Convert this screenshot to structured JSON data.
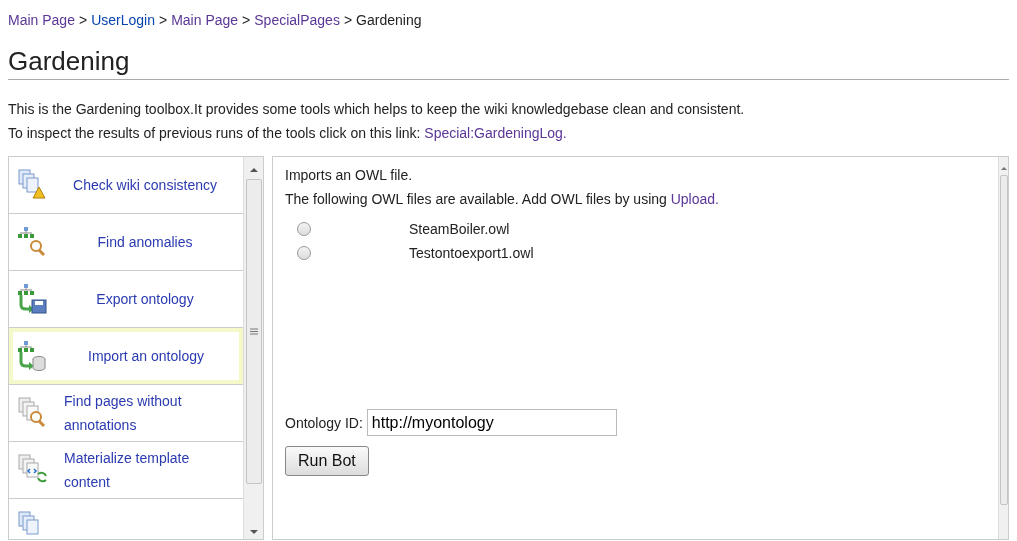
{
  "breadcrumb": [
    {
      "kind": "link",
      "text": "Main Page",
      "visited": true
    },
    {
      "kind": "separator",
      "text": ">"
    },
    {
      "kind": "link",
      "text": "UserLogin",
      "visited": false
    },
    {
      "kind": "separator",
      "text": ">"
    },
    {
      "kind": "link",
      "text": "Main Page",
      "visited": true
    },
    {
      "kind": "separator",
      "text": ">"
    },
    {
      "kind": "link",
      "text": "SpecialPages",
      "visited": true
    },
    {
      "kind": "separator",
      "text": ">"
    },
    {
      "kind": "current",
      "text": "Gardening"
    }
  ],
  "title": "Gardening",
  "intro": [
    {
      "text": "This is the Gardening toolbox.It provides some tools which helps to keep the wiki knowledgebase clean and consistent."
    },
    {
      "text": "To inspect the results of previous runs of the tools click on this link: ",
      "link": {
        "text": "Special:GardeningLog.",
        "visited": true
      }
    }
  ],
  "tools": [
    {
      "label": "Check wiki consistency",
      "selected": false
    },
    {
      "label": "Find anomalies",
      "selected": false
    },
    {
      "label": "Export ontology",
      "selected": false
    },
    {
      "label": "Import an ontology",
      "selected": true
    },
    {
      "label": "Find pages without annotations",
      "selected": false
    },
    {
      "label": "Materialize template content",
      "selected": false
    },
    {
      "selected": false
    }
  ],
  "panel": {
    "description": "Imports an OWL file.",
    "available": {
      "text": "The following OWL files are available. Add OWL files by using ",
      "link": {
        "text": "Upload.",
        "visited": true
      }
    },
    "files": [
      {
        "name": "SteamBoiler.owl",
        "selected": false
      },
      {
        "name": "Testontoexport1.owl",
        "selected": false
      }
    ],
    "ontology_id": {
      "label": "Ontology ID:",
      "value": "http://myontology"
    },
    "button": "Run Bot"
  }
}
